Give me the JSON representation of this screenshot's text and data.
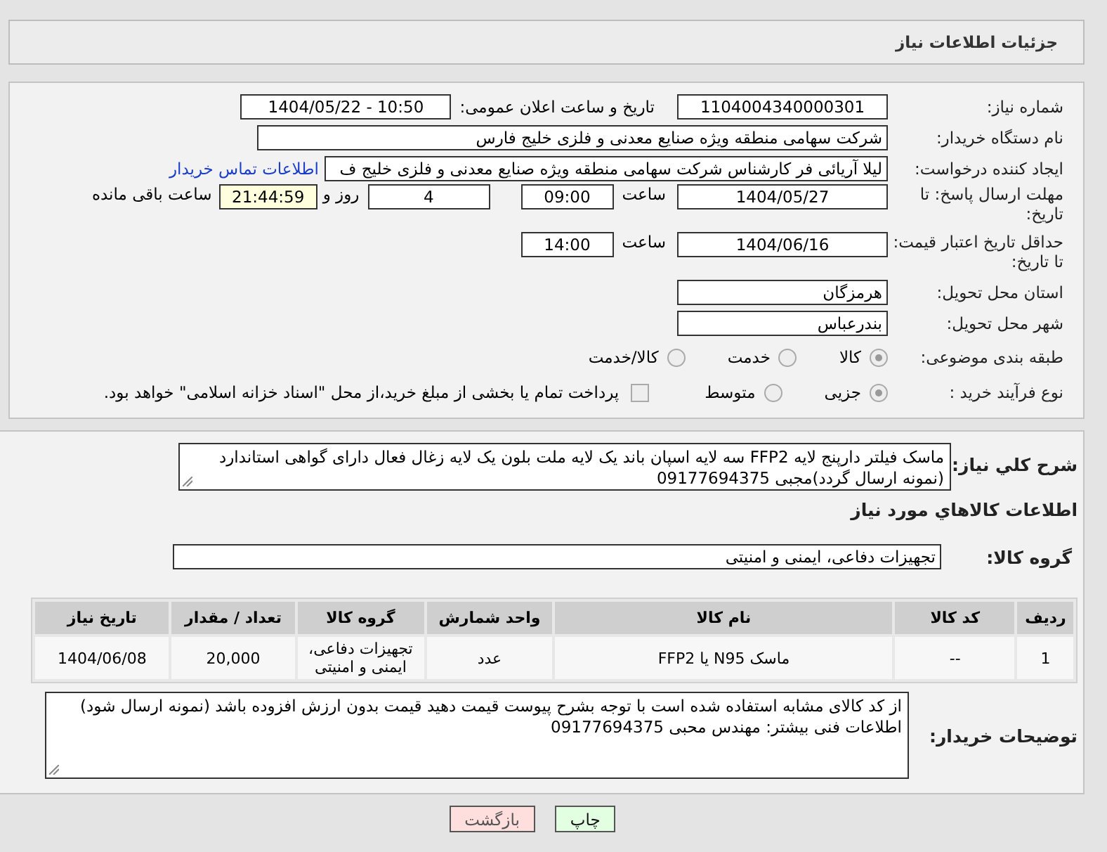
{
  "header": {
    "title": "جزئیات اطلاعات نیاز"
  },
  "need_number": {
    "label": "شماره نیاز:",
    "value": "1104004340000301"
  },
  "announce": {
    "label": "تاریخ و ساعت اعلان عمومی:",
    "value": "1404/05/22 - 10:50"
  },
  "buyer_org": {
    "label": "نام دستگاه خریدار:",
    "value": "شرکت سهامی منطقه ویژه صنایع معدنی و فلزی خلیج فارس"
  },
  "requester": {
    "label": "ایجاد کننده درخواست:",
    "value": "لیلا آریائی فر کارشناس شرکت سهامی منطقه ویژه صنایع معدنی و فلزی خلیج ف",
    "link": "اطلاعات تماس خریدار"
  },
  "deadline": {
    "label": "مهلت ارسال پاسخ: تا تاریخ:",
    "date": "1404/05/27",
    "time_label": "ساعت",
    "time": "09:00",
    "days": "4",
    "days_label": "روز و",
    "remaining": "21:44:59",
    "remaining_label": "ساعت باقی مانده"
  },
  "validity": {
    "label": "حداقل تاریخ اعتبار قیمت: تا تاریخ:",
    "date": "1404/06/16",
    "time_label": "ساعت",
    "time": "14:00"
  },
  "province": {
    "label": "استان محل تحویل:",
    "value": "هرمزگان"
  },
  "city": {
    "label": "شهر محل تحویل:",
    "value": "بندرعباس"
  },
  "category": {
    "label": "طبقه بندی موضوعی:",
    "options": [
      {
        "label": "کالا",
        "selected": true
      },
      {
        "label": "خدمت",
        "selected": false
      },
      {
        "label": "کالا/خدمت",
        "selected": false
      }
    ]
  },
  "process": {
    "label": "نوع فرآیند خرید :",
    "options": [
      {
        "label": "جزیی",
        "selected": true
      },
      {
        "label": "متوسط",
        "selected": false
      }
    ],
    "payment": {
      "label": "پرداخت تمام یا بخشی از مبلغ خرید،از محل \"اسناد خزانه اسلامی\" خواهد بود.",
      "checked": false
    }
  },
  "description": {
    "label": "شرح کلي نياز:",
    "value": "ماسک فیلتر دارپنج لایه FFP2 سه لایه اسپان باند یک لایه ملت بلون یک لایه زغال فعال دارای گواهی استاندارد (نمونه ارسال گردد)مجبی 09177694375"
  },
  "goods_title": "اطلاعات کالاهاي مورد نياز",
  "group": {
    "label": "گروه کالا:",
    "value": "تجهیزات دفاعی، ایمنی و امنیتی"
  },
  "table": {
    "columns": [
      "ردیف",
      "کد کالا",
      "نام کالا",
      "واحد شمارش",
      "گروه کالا",
      "تعداد / مقدار",
      "تاریخ نیاز"
    ],
    "rows": [
      [
        "1",
        "--",
        "ماسک N95 یا FFP2",
        "عدد",
        "تجهیزات دفاعی، ایمنی و امنیتی",
        "20,000",
        "1404/06/08"
      ]
    ]
  },
  "notes": {
    "label": "توضیحات خریدار:",
    "value": "از کد کالای مشابه استفاده شده است با توجه بشرح پیوست قیمت دهید قیمت بدون ارزش افزوده باشد (نمونه ارسال شود) اطلاعات فنی بیشتر: مهندس محبی 09177694375"
  },
  "buttons": [
    {
      "label": "چاپ",
      "kind": "print"
    },
    {
      "label": "بازگشت",
      "kind": "back"
    }
  ]
}
